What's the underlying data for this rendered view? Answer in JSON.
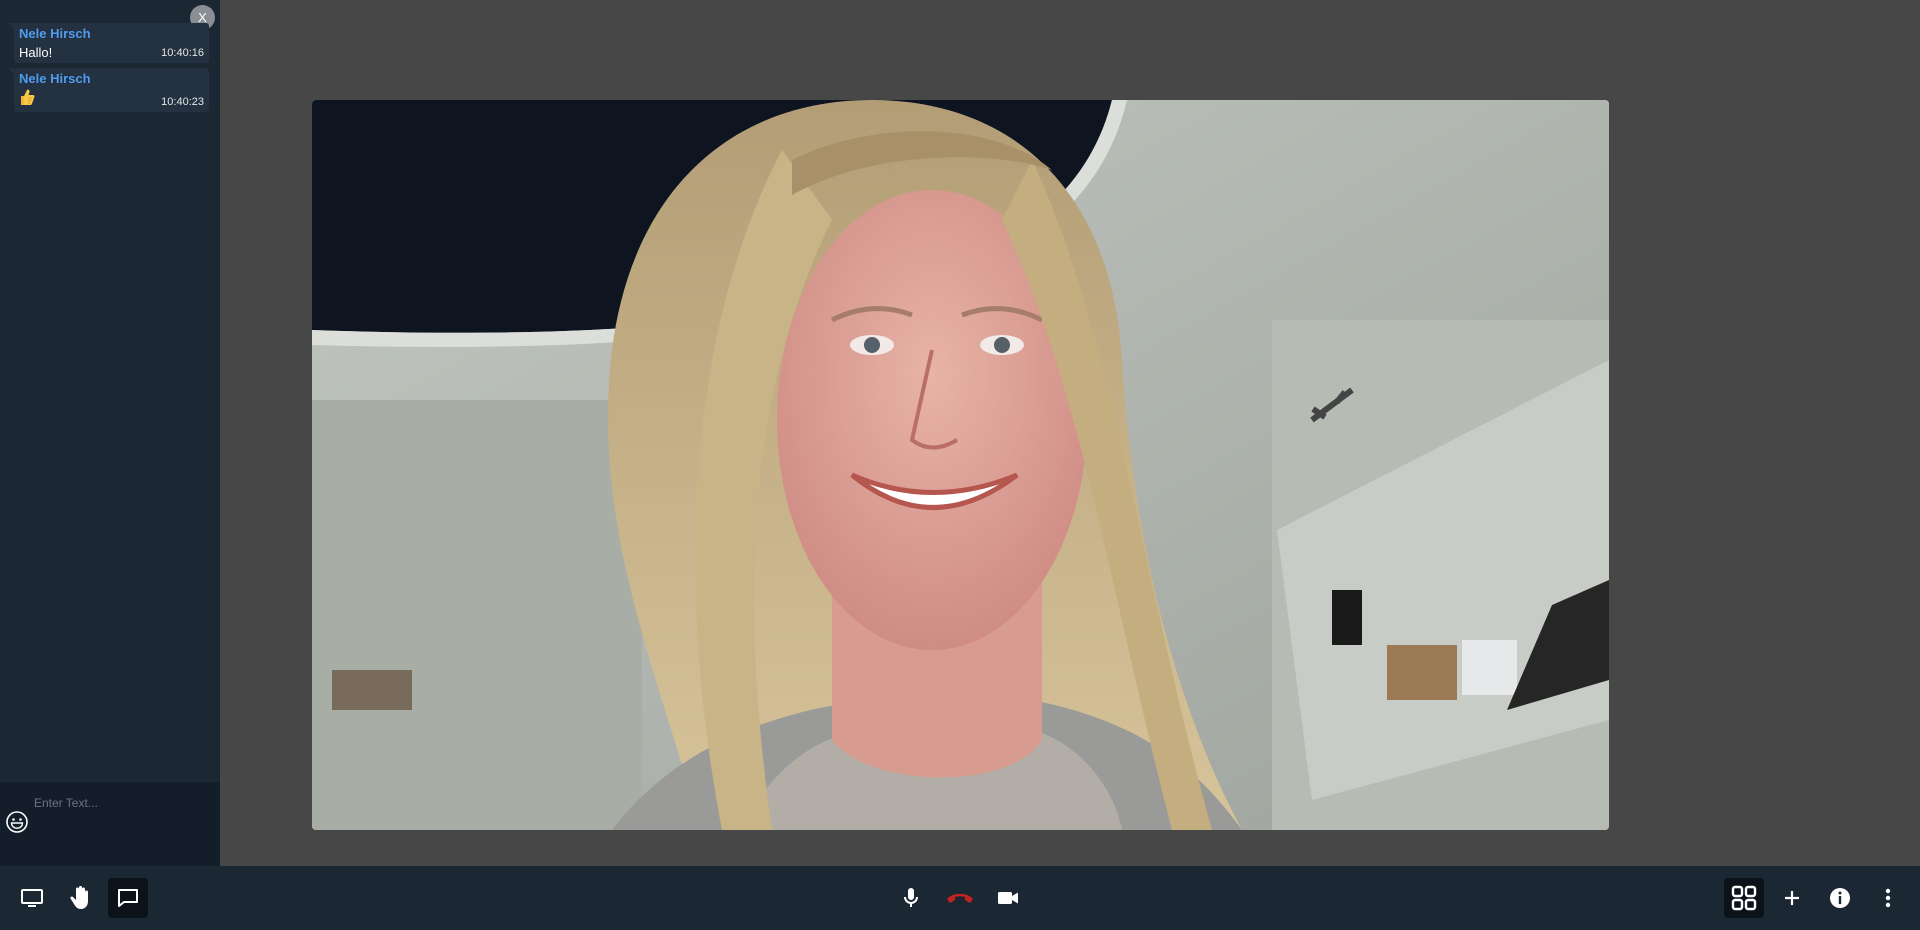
{
  "chat": {
    "close_label": "X",
    "messages": [
      {
        "author": "Nele Hirsch",
        "text": "Hallo!",
        "time": "10:40:16"
      },
      {
        "author": "Nele Hirsch",
        "emoji": "thumbs-up-emoji",
        "time": "10:40:23"
      }
    ],
    "input_placeholder": "Enter Text..."
  },
  "toolbar": {
    "left": [
      {
        "icon": "screen-share-icon"
      },
      {
        "icon": "raise-hand-icon"
      },
      {
        "icon": "chat-icon",
        "active": true
      }
    ],
    "center": [
      {
        "icon": "microphone-icon"
      },
      {
        "icon": "hangup-icon",
        "color": "#c42222"
      },
      {
        "icon": "camera-icon"
      }
    ],
    "right": [
      {
        "icon": "tile-view-icon",
        "active": true
      },
      {
        "icon": "add-icon"
      },
      {
        "icon": "info-icon"
      },
      {
        "icon": "more-icon"
      }
    ]
  },
  "video": {
    "participant": "participant-video"
  },
  "colors": {
    "author": "#4f9cef",
    "sidebar": "#1c2734",
    "stage": "#474747",
    "hangup": "#c42222"
  }
}
